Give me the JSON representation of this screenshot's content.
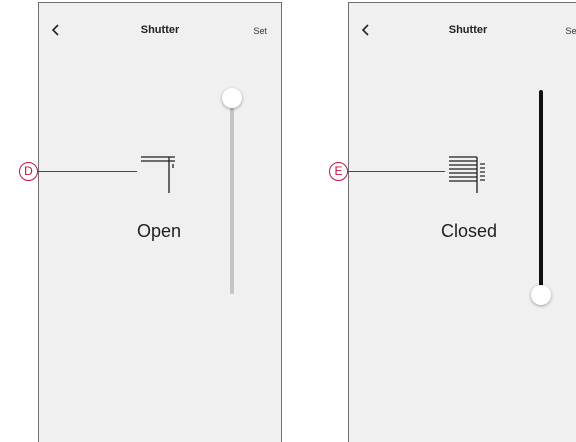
{
  "screens": [
    {
      "title": "Shutter",
      "set_label": "Set",
      "status": "Open",
      "shutter_icon": "shutter-open-icon",
      "slider_position_percent": 100
    },
    {
      "title": "Shutter",
      "set_label": "Set",
      "status": "Closed",
      "shutter_icon": "shutter-closed-icon",
      "slider_position_percent": 0
    }
  ],
  "callouts": [
    {
      "label": "D"
    },
    {
      "label": "E"
    }
  ],
  "colors": {
    "callout": "#c0143c",
    "screen_background": "#f0f0f0",
    "track_open": "#c4c4c4",
    "track_closed": "#111111"
  }
}
